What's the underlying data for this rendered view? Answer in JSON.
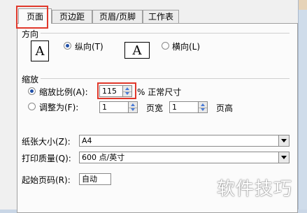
{
  "tabs": [
    {
      "label": "页面",
      "active": true
    },
    {
      "label": "页边距",
      "active": false
    },
    {
      "label": "页眉/页脚",
      "active": false
    },
    {
      "label": "工作表",
      "active": false
    }
  ],
  "orientation": {
    "title": "方向",
    "page_icon_letter": "A",
    "portrait_label": "纵向(T)",
    "landscape_label": "横向(L)",
    "selected": "portrait"
  },
  "scaling": {
    "title": "缩放",
    "adjust_label": "缩放比例(A):",
    "adjust_value": "115",
    "percent_suffix": "% 正常尺寸",
    "fit_label": "调整为(F):",
    "fit_wide_value": "1",
    "fit_wide_suffix": "页宽",
    "fit_tall_value": "1",
    "fit_tall_suffix": "页高",
    "selected": "adjust"
  },
  "paper_size": {
    "label": "纸张大小(Z):",
    "value": "A4"
  },
  "print_quality": {
    "label": "打印质量(Q):",
    "value": "600 点/英寸"
  },
  "first_page_number": {
    "label": "起始页码(R):",
    "value": "自动"
  },
  "watermark": "软件技巧",
  "colors": {
    "highlight": "#e0382b",
    "radio_dot": "#1f4fa8",
    "spin_arrow": "#4a7bd6"
  }
}
